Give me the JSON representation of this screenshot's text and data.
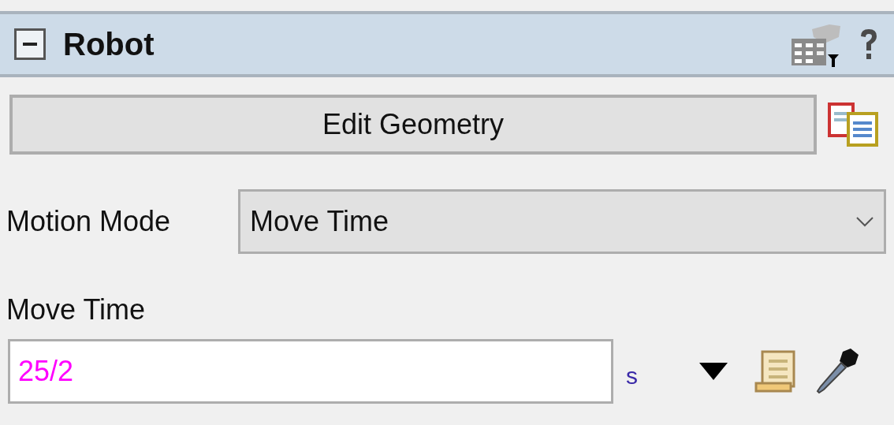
{
  "panel": {
    "title": "Robot",
    "expanded": true
  },
  "edit_button": {
    "label": "Edit Geometry"
  },
  "motion_mode": {
    "label": "Motion Mode",
    "value": "Move Time"
  },
  "move_time": {
    "label": "Move Time",
    "value": "25/2",
    "unit": "s"
  }
}
